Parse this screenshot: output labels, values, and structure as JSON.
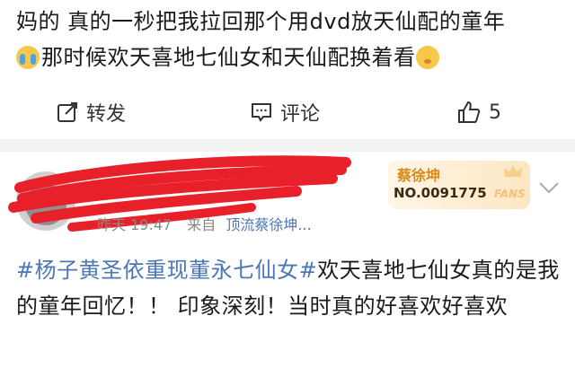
{
  "post1": {
    "text_line1": "妈的 真的一秒把我拉回那个用dvd放天仙配的童年",
    "text_line2": "那时候欢天喜地七仙女和天仙配换着看"
  },
  "actions": {
    "repost_label": "转发",
    "comment_label": "评论",
    "like_count": "5"
  },
  "post2": {
    "time": "昨天 19:47",
    "from_label": "来自",
    "source": "顶流蔡徐坤...",
    "fans_badge": {
      "name": "蔡徐坤",
      "number": "NO.0091775",
      "tag": "FANS"
    },
    "hashtag": "#杨子黄圣依重现董永七仙女#",
    "body": "欢天喜地七仙女真的是我的童年回忆！！ 印象深刻！当时真的好喜欢好喜欢"
  },
  "colors": {
    "link": "#4c77b3",
    "badge_gold": "#d98a1b",
    "divider": "#f2f2f2",
    "redaction": "#e8202a"
  },
  "icons": [
    "crying-emoji-icon",
    "shy-emoji-icon",
    "repost-icon",
    "comment-icon",
    "thumbs-up-icon",
    "crown-icon",
    "chevron-down-icon"
  ]
}
